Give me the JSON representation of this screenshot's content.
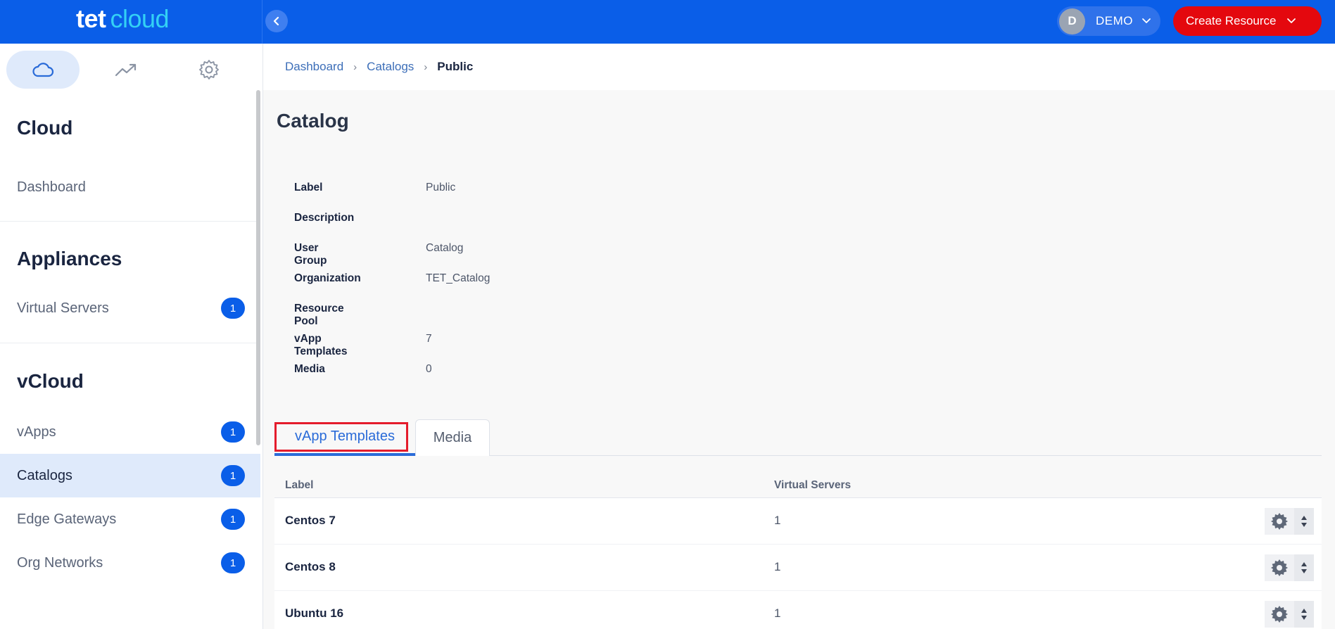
{
  "brand": {
    "tet": "tet",
    "cloud": "cloud"
  },
  "user": {
    "initial": "D",
    "name": "DEMO"
  },
  "create_button": "Create Resource",
  "sidebar": {
    "tabs": [
      {
        "icon": "cloud-icon",
        "active": true
      },
      {
        "icon": "trending-icon",
        "active": false
      },
      {
        "icon": "gear-icon",
        "active": false
      }
    ],
    "sections": [
      {
        "title": "Cloud",
        "items": [
          {
            "label": "Dashboard"
          }
        ]
      },
      {
        "title": "Appliances",
        "items": [
          {
            "label": "Virtual Servers",
            "badge": "1"
          }
        ]
      },
      {
        "title": "vCloud",
        "items": [
          {
            "label": "vApps",
            "badge": "1"
          },
          {
            "label": "Catalogs",
            "badge": "1",
            "active": true
          },
          {
            "label": "Edge Gateways",
            "badge": "1"
          },
          {
            "label": "Org Networks",
            "badge": "1"
          }
        ]
      }
    ]
  },
  "breadcrumb": [
    "Dashboard",
    "Catalogs",
    "Public"
  ],
  "page_title": "Catalog",
  "properties": [
    {
      "key": "Label",
      "value": "Public"
    },
    {
      "key": "Description",
      "value": ""
    },
    {
      "key": "User Group",
      "value": "Catalog"
    },
    {
      "key": "Organization",
      "value": "TET_Catalog"
    },
    {
      "key": "Resource Pool",
      "value": ""
    },
    {
      "key": "vApp Templates",
      "value": "7"
    },
    {
      "key": "Media",
      "value": "0"
    }
  ],
  "tabs": [
    {
      "label": "vApp Templates",
      "active": true
    },
    {
      "label": "Media",
      "active": false
    }
  ],
  "table": {
    "columns": [
      "Label",
      "Virtual Servers"
    ],
    "rows": [
      {
        "label": "Centos 7",
        "virtual_servers": "1"
      },
      {
        "label": "Centos 8",
        "virtual_servers": "1"
      },
      {
        "label": "Ubuntu 16",
        "virtual_servers": "1"
      }
    ]
  },
  "colors": {
    "primary": "#0a5ee8",
    "brand_accent": "#33d1f5",
    "create_button": "#e4080e",
    "highlight_box": "#e41c2c"
  }
}
